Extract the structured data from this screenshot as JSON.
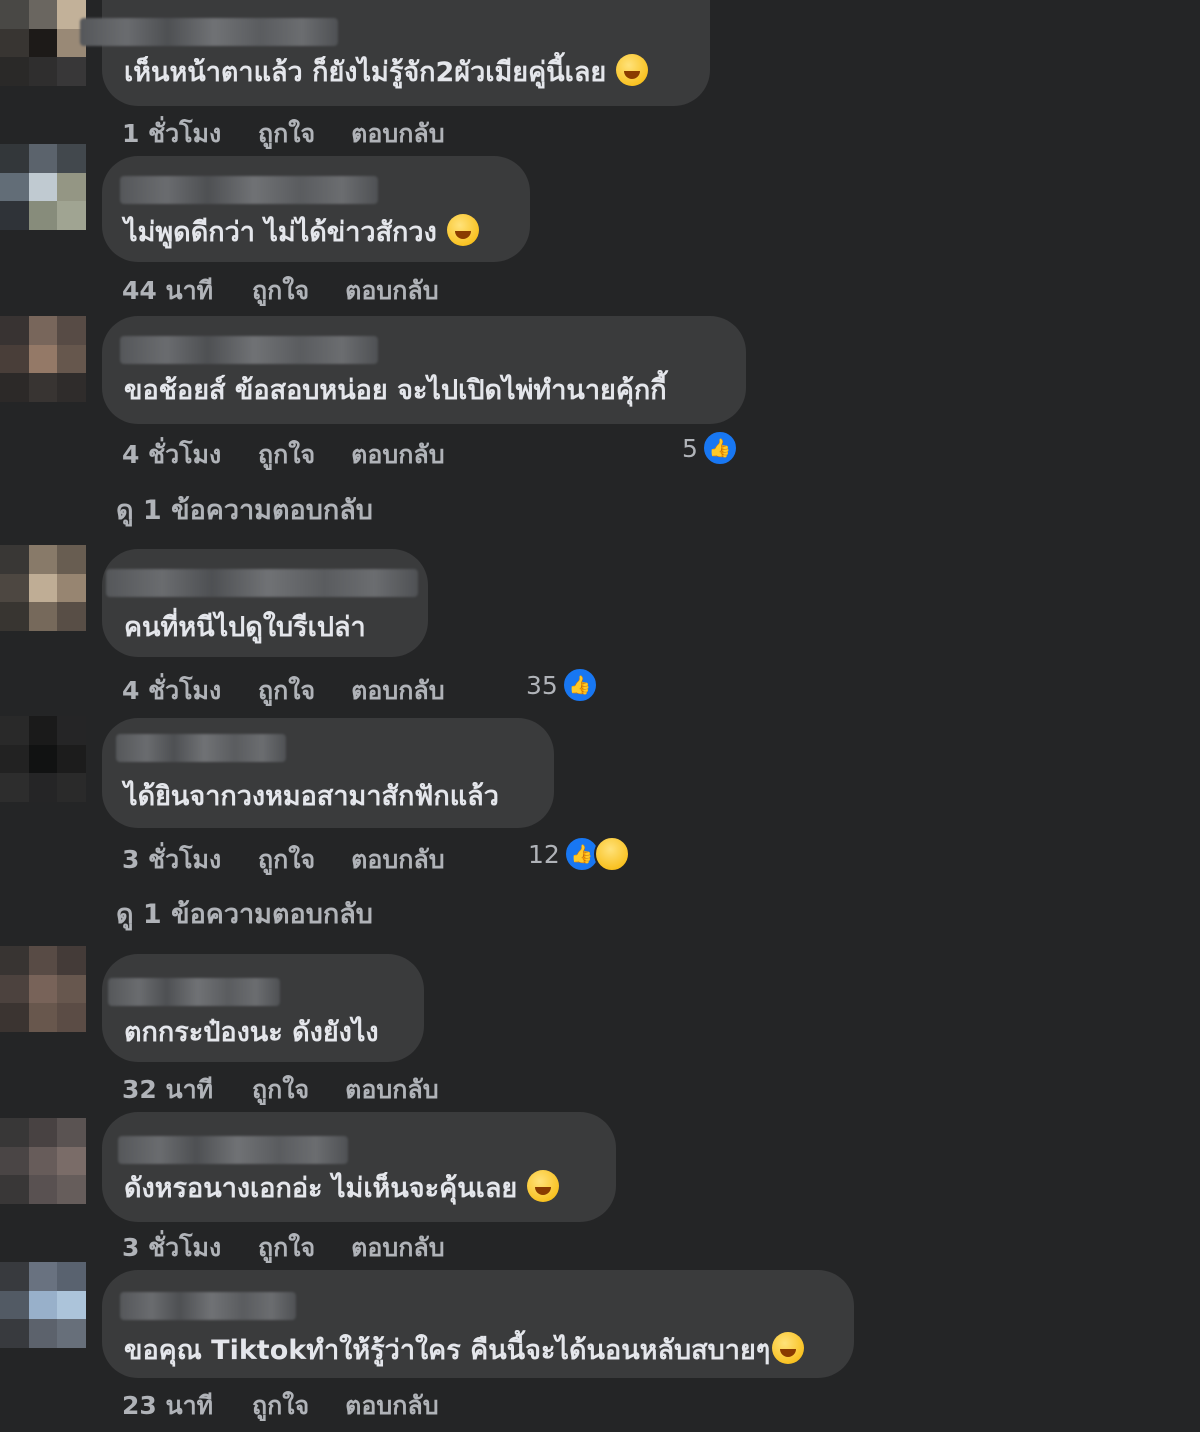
{
  "comments": [
    {
      "text": "เห็นหน้าตาแล้ว ก็ยังไม่รู้จัก2ผัวเมียคู่นี้เลย",
      "emoji": "tears-of-joy-emoji",
      "time": "1 ชั่วโมง",
      "like": "ถูกใจ",
      "reply": "ตอบกลับ"
    },
    {
      "text": "ไม่พูดดีกว่า ไม่ได้ข่าวสักวง",
      "emoji": "hand-over-mouth-emoji",
      "time": "44 นาที",
      "like": "ถูกใจ",
      "reply": "ตอบกลับ"
    },
    {
      "text": "ขอช้อยส์ ข้อสอบหน่อย จะไปเปิดไพ่ทำนายคุ้กกี้",
      "time": "4 ชั่วโมง",
      "like": "ถูกใจ",
      "reply": "ตอบกลับ",
      "reaction_count": "5",
      "view_replies": "ดู 1 ข้อความตอบกลับ"
    },
    {
      "text": "คนที่หนีไปดูใบรีเปล่า",
      "time": "4 ชั่วโมง",
      "like": "ถูกใจ",
      "reply": "ตอบกลับ",
      "reaction_count": "35"
    },
    {
      "text": "ได้ยินจากวงหมอสามาสักฟักแล้ว",
      "time": "3 ชั่วโมง",
      "like": "ถูกใจ",
      "reply": "ตอบกลับ",
      "reaction_count": "12",
      "view_replies": "ดู 1 ข้อความตอบกลับ"
    },
    {
      "text": "ตกกระป๋องนะ ดังยังไง",
      "time": "32 นาที",
      "like": "ถูกใจ",
      "reply": "ตอบกลับ"
    },
    {
      "text": "ดังหรอนางเอกอ่ะ ไม่เห็นจะคุ้นเลย",
      "emoji": "rolling-laughing-emoji",
      "time": "3 ชั่วโมง",
      "like": "ถูกใจ",
      "reply": "ตอบกลับ"
    },
    {
      "text": "ขอคุณ Tiktokทำให้รู้ว่าใคร คืนนี้จะได้นอนหลับสบายๆ",
      "emoji": "grinning-squint-emoji",
      "time": "23 นาที",
      "like": "ถูกใจ",
      "reply": "ตอบกลับ"
    }
  ],
  "colors": {
    "background": "#242526",
    "bubble": "#3a3b3c",
    "text": "#e4e6eb",
    "meta": "#b0b3b8",
    "like_blue": "#1877f2"
  },
  "icons": {
    "like": "thumbs-up-icon",
    "haha": "haha-icon"
  }
}
